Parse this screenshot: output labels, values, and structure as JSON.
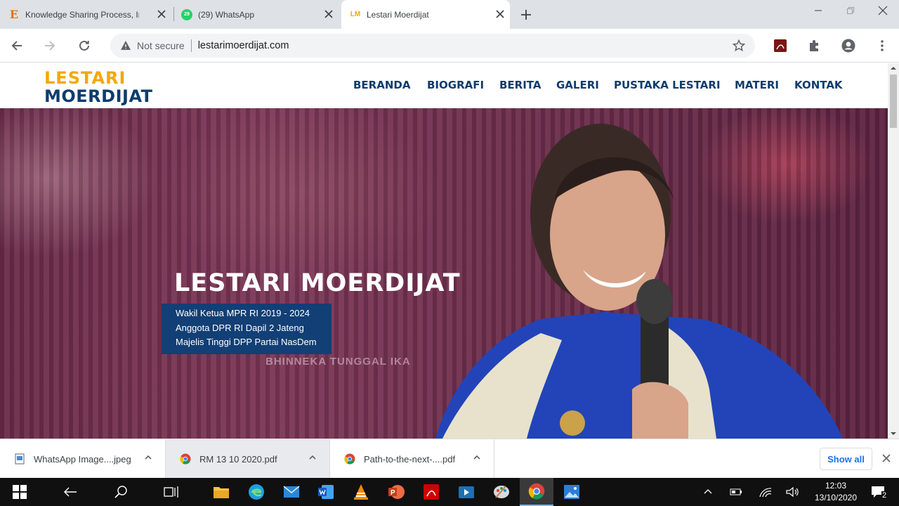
{
  "browser": {
    "tabs": [
      {
        "title": "Knowledge Sharing Process, In",
        "favicon": "E"
      },
      {
        "title": "(29) WhatsApp",
        "favicon": "29"
      },
      {
        "title": "Lestari Moerdijat",
        "favicon": "LM"
      }
    ],
    "omnibox": {
      "security": "Not secure",
      "url": "lestarimoerdijat.com"
    }
  },
  "site": {
    "logo": {
      "line1": "LESTARI",
      "line2": "MOERDIJAT"
    },
    "nav": [
      "BERANDA",
      "BIOGRAFI",
      "BERITA",
      "GALERI",
      "PUSTAKA LESTARI",
      "MATERI",
      "KONTAK"
    ],
    "hero": {
      "title": "LESTARI MOERDIJAT",
      "lines": [
        "Wakil Ketua MPR RI 2019 - 2024",
        "Anggota DPR RI Dapil 2 Jateng",
        "Majelis Tinggi DPP Partai NasDem"
      ],
      "motto": "BHINNEKA TUNGGAL IKA"
    }
  },
  "downloads": {
    "items": [
      "WhatsApp Image....jpeg",
      "RM 13 10 2020.pdf",
      "Path-to-the-next-....pdf"
    ],
    "show_all": "Show all"
  },
  "taskbar": {
    "time": "12:03",
    "date": "13/10/2020",
    "notifications": "2"
  },
  "colors": {
    "brand_navy": "#0d3c6e",
    "brand_gold": "#f2a900",
    "hero_box": "#123f75"
  }
}
